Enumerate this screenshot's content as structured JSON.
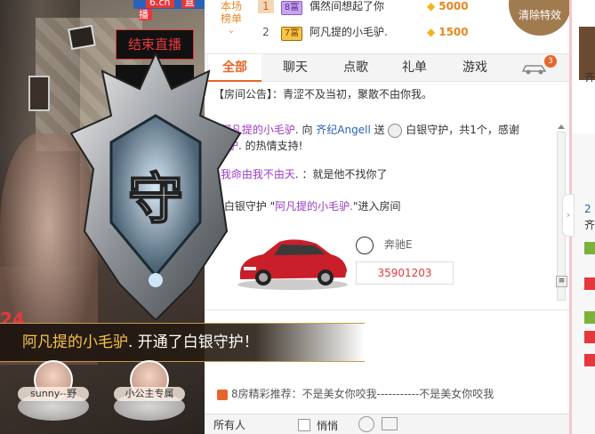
{
  "video": {
    "top_badge_left": "6.cn",
    "top_badge_right": "直播",
    "end_live_label": "结束直播",
    "overlay_number": "24",
    "notice": {
      "name": "阿凡提的小毛驴",
      "text": ". 开通了白银守护！"
    },
    "shield_char": "守",
    "avatars": [
      {
        "label": "sunny--野"
      },
      {
        "label": "小公主专属"
      }
    ]
  },
  "rank": {
    "header": "本场\n榜单",
    "rows": [
      {
        "num": "1",
        "level": "8富",
        "name": "偶然间想起了你",
        "coins": "5000"
      },
      {
        "num": "2",
        "level": "7富",
        "name": "阿凡提的小毛驴.",
        "coins": "1500"
      }
    ],
    "clear_effects": "清除特效"
  },
  "tabs": {
    "items": [
      "全部",
      "聊天",
      "点歌",
      "礼单",
      "游戏"
    ],
    "active": 0,
    "badge": "3"
  },
  "announce": {
    "label": "【房间公告】",
    "text": "：青涩不及当初，聚散不由你我。"
  },
  "chat": {
    "m1": {
      "a": "阿凡提的小毛驴",
      "b": ". 向 ",
      "c": "齐纪Angell",
      "d": " 送",
      "e": " 白银守护，共1个，感谢"
    },
    "m1b": {
      "a": "小毛驴",
      "b": ". 的热情支持!"
    },
    "m2": {
      "name": "我命由我不由天",
      "text": ". ：就是他不找你了"
    },
    "m3": {
      "pre": "白银守护 \"",
      "name": "阿凡提的小毛驴.",
      "post": "\"进入房间"
    },
    "car": {
      "name": "奔驰E",
      "number": "35901203"
    }
  },
  "recommend": {
    "text": "8房精彩推荐：不是美女你咬我-----------不是美女你咬我"
  },
  "input": {
    "target": "所有人",
    "whisper": "悄悄"
  },
  "right": {
    "t1": "齐",
    "t2": "2",
    "t3": "齐"
  },
  "colors": {
    "accent": "#e5662a",
    "purple": "#9b3bc4",
    "blue": "#2a62b8",
    "red": "#e5383b"
  }
}
